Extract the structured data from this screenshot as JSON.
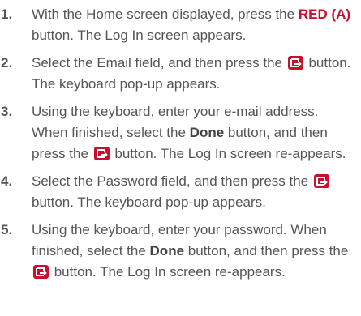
{
  "steps": [
    {
      "number": "1.",
      "parts": [
        {
          "type": "text",
          "text": "With the Home screen displayed, press the "
        },
        {
          "type": "red",
          "text": "RED (A)"
        },
        {
          "type": "text",
          "text": " button. The Log In screen appears."
        }
      ]
    },
    {
      "number": "2.",
      "parts": [
        {
          "type": "text",
          "text": "Select the Email field, and then press the "
        },
        {
          "type": "icon",
          "icon": "enter-icon"
        },
        {
          "type": "text",
          "text": " button. The keyboard pop-up appears."
        }
      ]
    },
    {
      "number": "3.",
      "parts": [
        {
          "type": "text",
          "text": "Using the keyboard, enter your e-mail address. When finished, select the "
        },
        {
          "type": "bold",
          "text": "Done"
        },
        {
          "type": "text",
          "text": " button, and then press the "
        },
        {
          "type": "icon",
          "icon": "enter-icon"
        },
        {
          "type": "text",
          "text": " button. The Log In screen re-appears."
        }
      ]
    },
    {
      "number": "4.",
      "parts": [
        {
          "type": "text",
          "text": "Select the Password field, and then press the "
        },
        {
          "type": "icon",
          "icon": "enter-icon"
        },
        {
          "type": "text",
          "text": " button. The keyboard pop-up appears."
        }
      ]
    },
    {
      "number": "5.",
      "parts": [
        {
          "type": "text",
          "text": "Using the keyboard, enter your password. When finished, select the "
        },
        {
          "type": "bold",
          "text": "Done"
        },
        {
          "type": "text",
          "text": " button, and then press the "
        },
        {
          "type": "icon",
          "icon": "enter-icon"
        },
        {
          "type": "text",
          "text": " button. The Log In screen re-appears."
        }
      ]
    }
  ],
  "colors": {
    "text": "#555555",
    "accent_red": "#c8102e",
    "icon_fill": "#c8102e"
  }
}
